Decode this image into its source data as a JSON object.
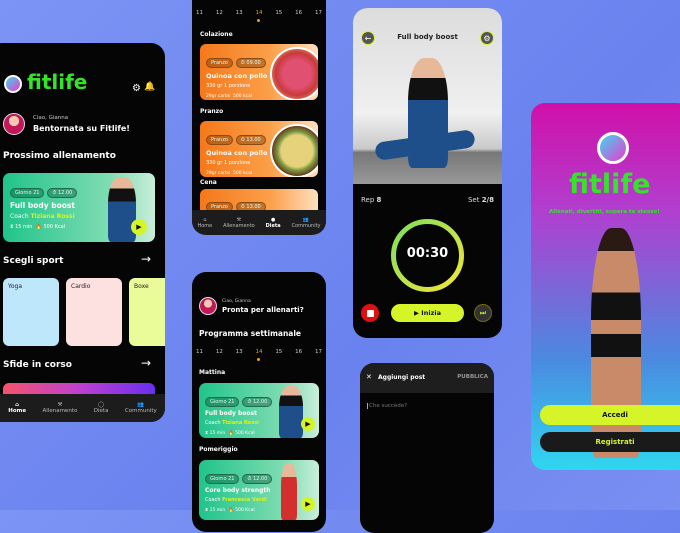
{
  "colors": {
    "brand_green": "#35e32a",
    "accent_lime": "#d6f528",
    "diet_orange": "#f5781a",
    "background": "#7089f2"
  },
  "home": {
    "logo": "fitlife",
    "greeting": "Ciao, Gianna",
    "welcome": "Bentornata su Fitlife!",
    "next_title": "Prossimo allenamento",
    "card": {
      "day": "Giorno 21",
      "time": "⏱ 12.00",
      "title": "Full body boost",
      "coach_prefix": "Coach",
      "coach": "Tiziana Rossi",
      "duration": "⧗ 15 min",
      "kcal": "🔥 500 Kcal"
    },
    "sports_title": "Scegli sport",
    "sports": [
      "Yoga",
      "Cardio",
      "Boxe"
    ],
    "challenges_title": "Sfide in corso",
    "nav": [
      "Home",
      "Allenamento",
      "Dieta",
      "Community"
    ]
  },
  "diet": {
    "dates": [
      "11",
      "12",
      "13",
      "14",
      "15",
      "16",
      "17"
    ],
    "selected_date": "14",
    "meals": [
      {
        "section": "Colazione",
        "tag": "Pranzo",
        "time": "⏱ 09.00",
        "title": "Quinoa con pollo",
        "qty": "330 gr  1 porzione",
        "carbs": "29gr carbs",
        "kcal": "500 kcal"
      },
      {
        "section": "Pranzo",
        "tag": "Pranzo",
        "time": "⏱ 13.00",
        "title": "Quinoa con pollo",
        "qty": "330 gr  1 porzione",
        "carbs": "29gr carbs",
        "kcal": "500 kcal"
      },
      {
        "section": "Cena",
        "tag": "Pranzo",
        "time": "⏱ 13.00"
      }
    ],
    "nav": [
      "Home",
      "Allenamento",
      "Dieta",
      "Community"
    ],
    "active_nav": "Dieta"
  },
  "program": {
    "greeting": "Ciao, Gianna",
    "title": "Pronta per allenarti?",
    "week_title": "Programma settimanale",
    "dates": [
      "11",
      "12",
      "13",
      "14",
      "15",
      "16",
      "17"
    ],
    "selected_date": "14",
    "sessions": [
      {
        "section": "Mattina",
        "day": "Giorno 21",
        "time": "⏱ 12.00",
        "title": "Full body boost",
        "coach_prefix": "Coach",
        "coach": "Tiziana Rossi",
        "duration": "⧗ 15 min",
        "kcal": "🔥 500 Kcal"
      },
      {
        "section": "Pomeriggio",
        "day": "Giorno 21",
        "time": "⏱ 12.00",
        "title": "Core body strength",
        "coach_prefix": "Coach",
        "coach": "Francesca Verdi",
        "duration": "⧗ 15 min",
        "kcal": "🔥 500 Kcal"
      }
    ]
  },
  "workout": {
    "title": "Full body boost",
    "rep_label": "Rep",
    "rep": "8",
    "set_label": "Set",
    "set": "2/8",
    "timer": "00:30",
    "progress": 0.75,
    "start": "▶ Inizia"
  },
  "post": {
    "close": "✕",
    "title": "Aggiungi post",
    "publish": "PUBBLICA",
    "placeholder": "Che succede?"
  },
  "login": {
    "logo": "fitlife",
    "tagline": "Allenati, divertiti, supera te stesso!",
    "login": "Accedi",
    "register": "Registrati"
  }
}
